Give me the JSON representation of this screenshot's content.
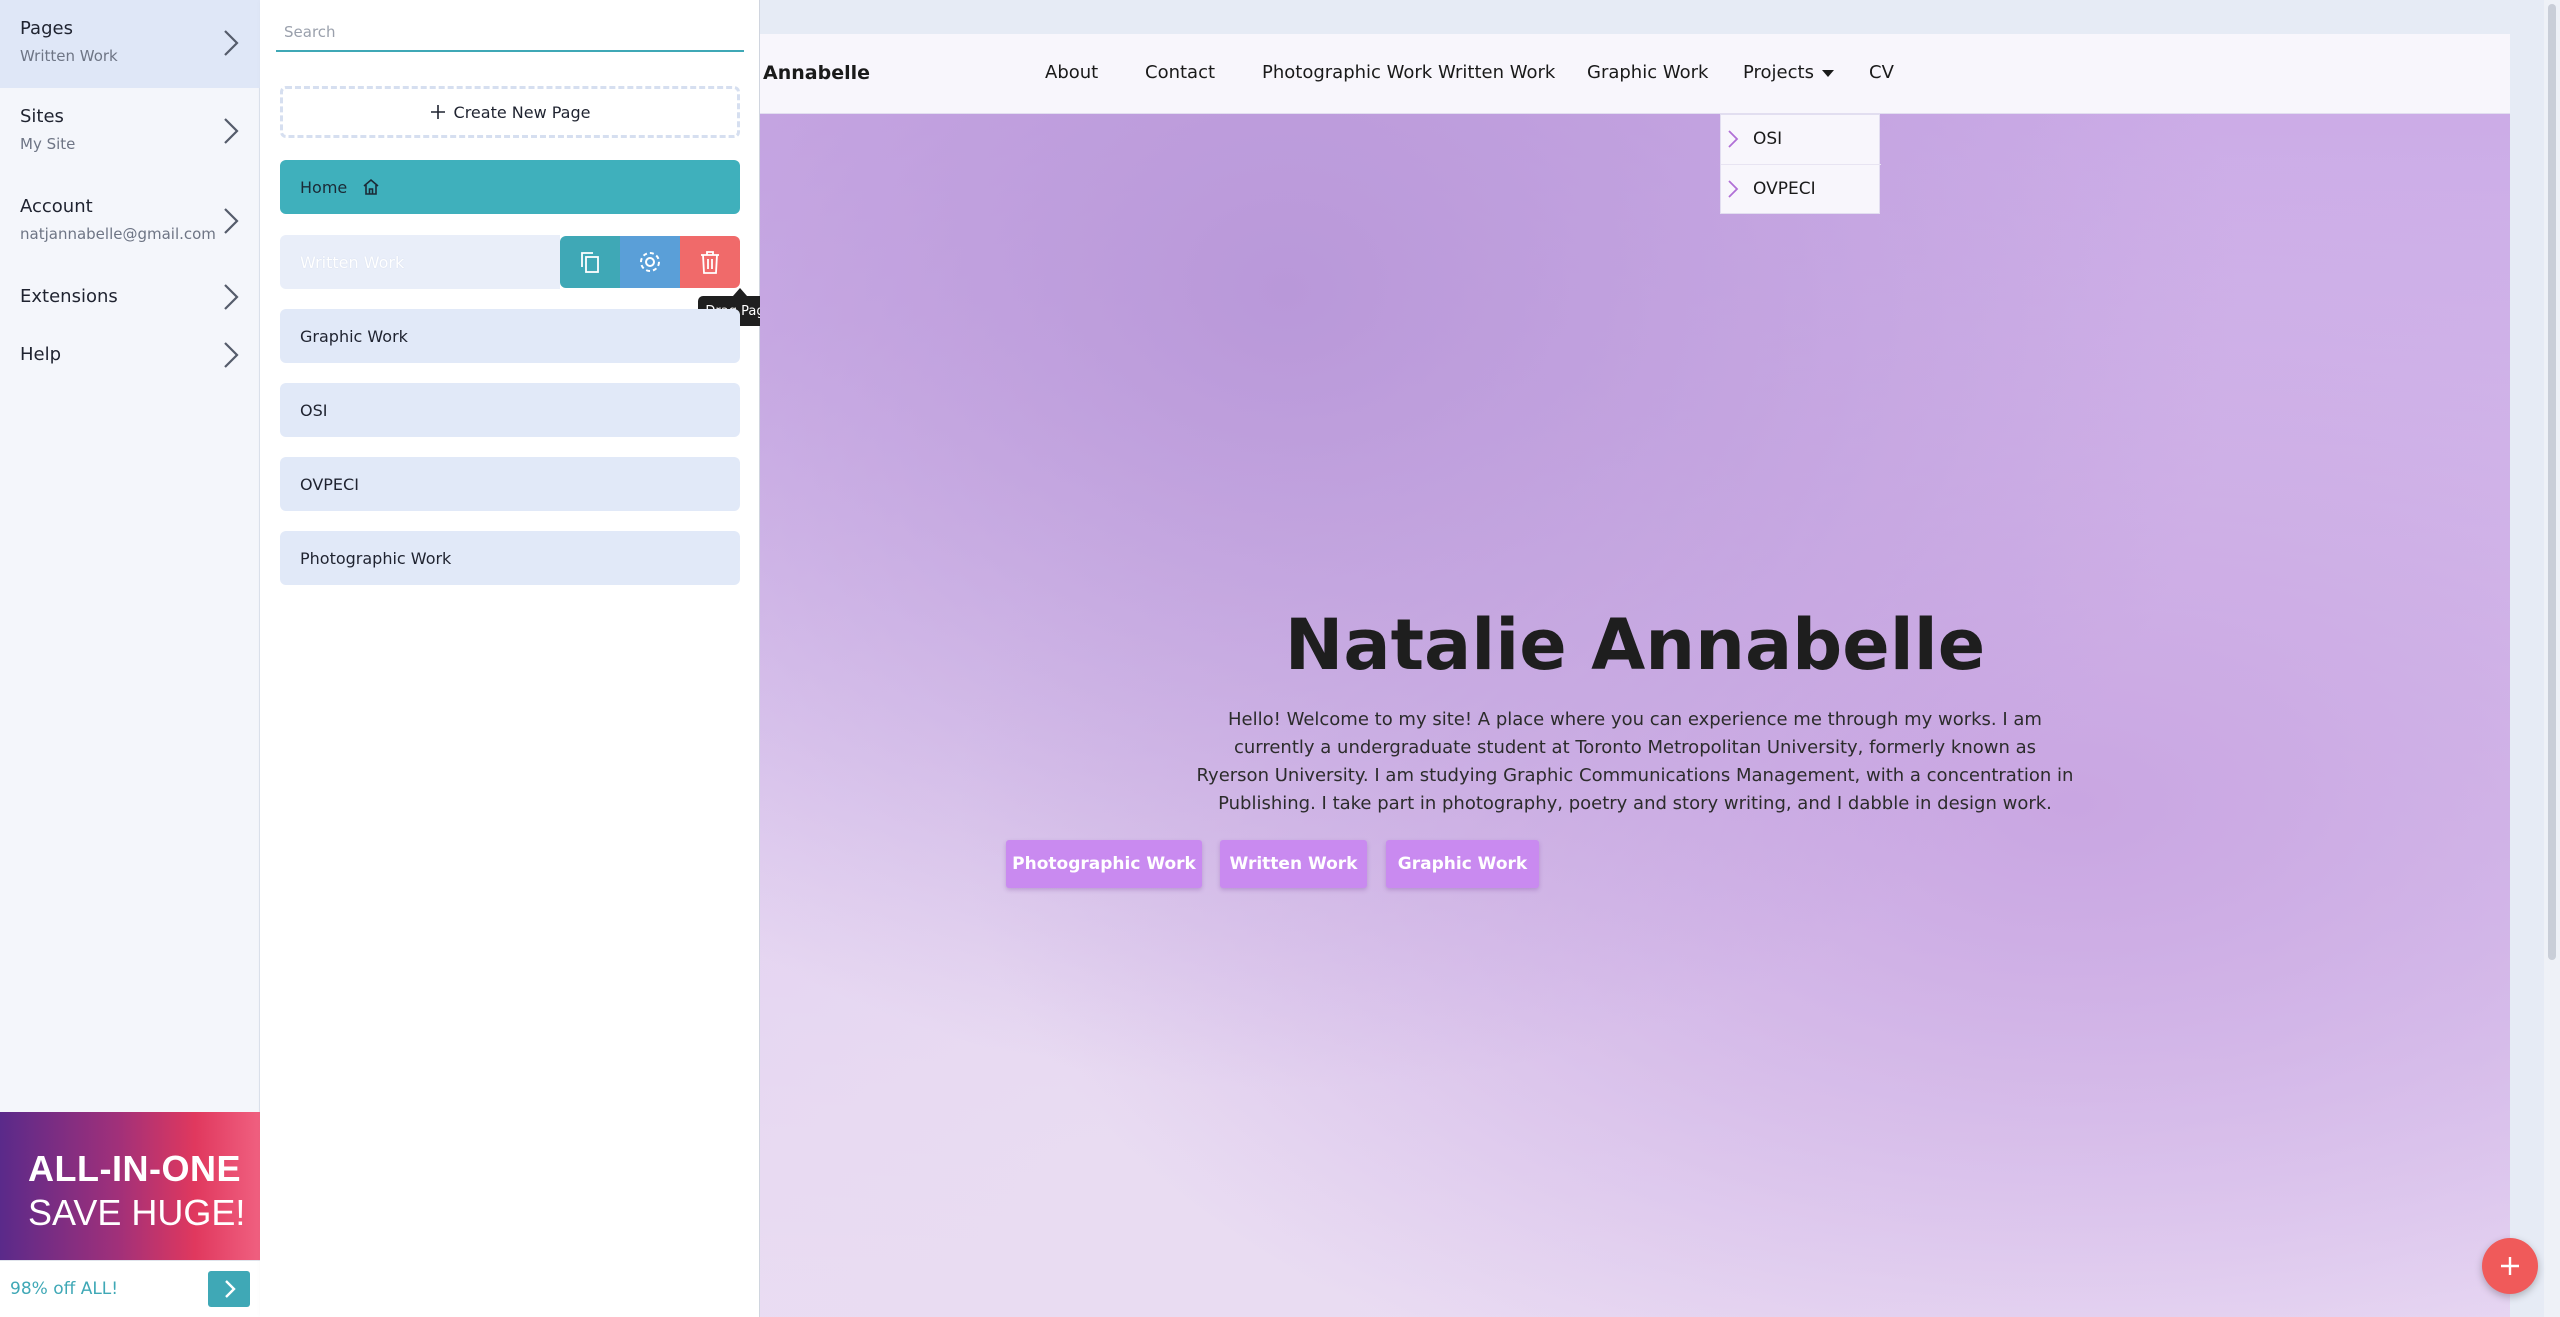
{
  "nav": {
    "items": [
      {
        "title": "Pages",
        "subtitle": "Written Work"
      },
      {
        "title": "Sites",
        "subtitle": "My Site"
      },
      {
        "title": "Account",
        "subtitle": "natjannabelle@gmail.com"
      },
      {
        "title": "Extensions"
      },
      {
        "title": "Help"
      }
    ]
  },
  "promo": {
    "line1": "ALL-IN-ONE",
    "line2": "SAVE HUGE!",
    "offer": "98% off ALL!"
  },
  "pages_panel": {
    "search_placeholder": "Search",
    "create_label": "Create New Page",
    "pages": [
      "Home",
      "Written Work",
      "Graphic Work",
      "OSI",
      "OVPECI",
      "Photographic Work"
    ],
    "tooltip": "Drag Page"
  },
  "site": {
    "brand": "Natalie Annabelle",
    "menu": [
      "About",
      "Contact",
      "Photographic Work",
      "Written Work",
      "Graphic Work",
      "Projects",
      "CV"
    ],
    "dropdown": [
      "OSI",
      "OVPECI"
    ],
    "hero_title": "Natalie Annabelle",
    "hero_text": "Hello! Welcome to my site! A place where you can experience me through my works. I am currently a undergraduate student at Toronto Metropolitan University, formerly known as Ryerson University. I am studying Graphic Communications Management, with a concentration in Publishing. I take part in photography, poetry and story writing, and I dabble in design work.",
    "buttons": [
      "Photographic Work",
      "Written Work",
      "Graphic Work"
    ]
  },
  "colors": {
    "accent": "#3fa8b6",
    "danger": "#f06a6a",
    "cta": "#c98af0",
    "fab": "#f05a5a"
  }
}
